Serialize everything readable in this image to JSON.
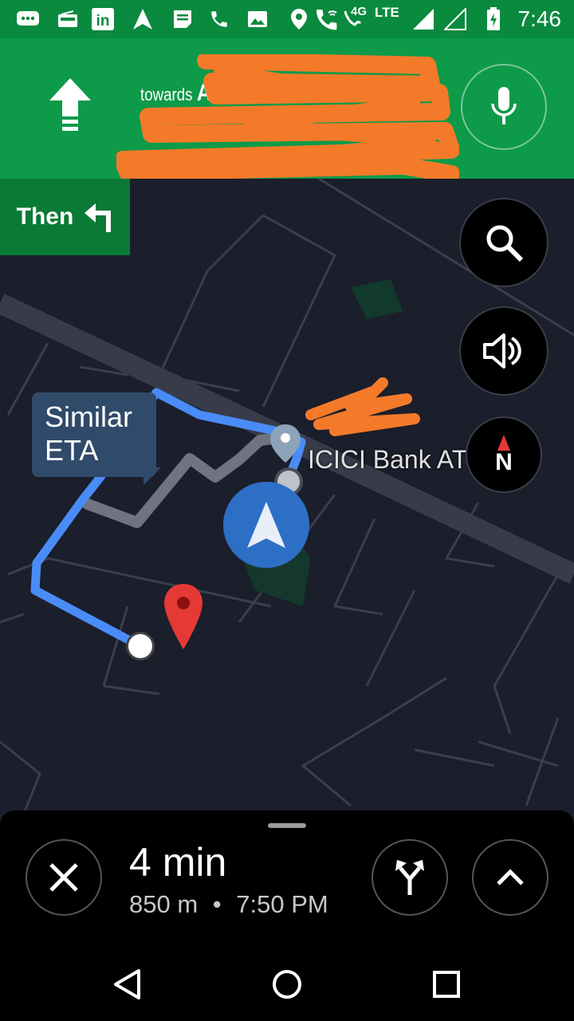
{
  "status_bar": {
    "time": "7:46",
    "network": "4G",
    "lte": "LTE",
    "icons": [
      "messages-icon",
      "radio-icon",
      "linkedin-icon",
      "navigation-icon",
      "notes-icon",
      "phone-icon",
      "gallery-icon",
      "location-icon",
      "wifi-call-icon",
      "wifi-call-icon",
      "signal-icon",
      "signal-empty-icon",
      "battery-charging-icon"
    ]
  },
  "nav_header": {
    "towards": "towards",
    "street_visible_start": "A",
    "maneuver_icon": "arrow-straight-icon",
    "mic_icon": "mic-icon",
    "colors": {
      "primary": "#0d9a49",
      "dark": "#0a7a36",
      "redaction": "#f47a2a"
    }
  },
  "then_panel": {
    "label": "Then",
    "icon": "turn-left-icon"
  },
  "map": {
    "eta_bubble": "Similar ETA",
    "eta_bubble_line1": "Similar",
    "eta_bubble_line2": "ETA",
    "poi_label": "ICICI Bank AT",
    "route_color": "#4a8cf7",
    "alt_route_color": "#6f7480"
  },
  "controls": {
    "search_icon": "search-icon",
    "volume_icon": "volume-icon",
    "compass_letter": "N"
  },
  "trip": {
    "duration": "4 min",
    "distance": "850 m",
    "separator": "•",
    "arrival": "7:50 PM",
    "details": "850 m  •  7:50 PM"
  },
  "android_nav": {
    "back": "back-icon",
    "home": "home-icon",
    "recents": "recents-icon"
  }
}
